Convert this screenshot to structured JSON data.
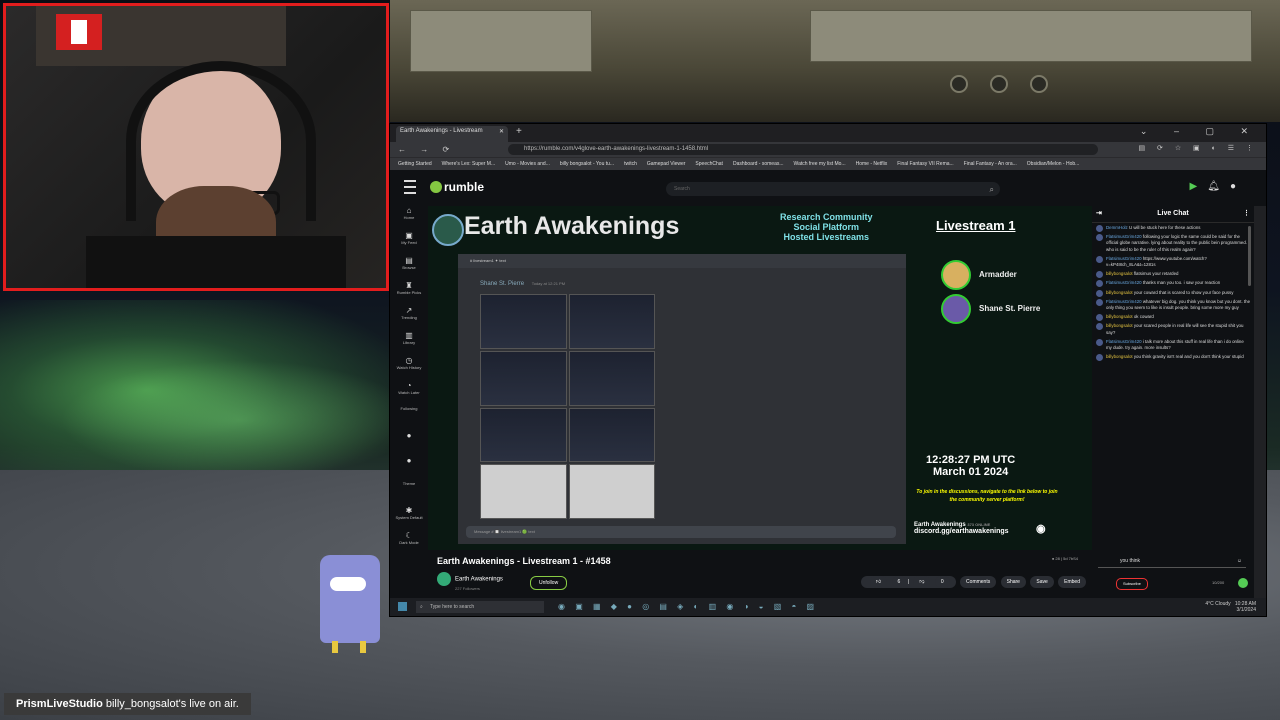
{
  "browser": {
    "tab_title": "Earth Awakenings - Livestream",
    "url": "https://rumble.com/v4glove-earth-awakenings-livestream-1-1458.html",
    "bookmarks": [
      "Getting Started",
      "Where's Lex: Super M...",
      "Umo - Movies and...",
      "billy bongsalot - You tu...",
      "twitch",
      "Gamepad Viewer",
      "SpeechChat",
      "Dashboard - someas...",
      "Watch free my list Mo...",
      "Home - Netflix",
      "Final Fantasy VII Rema...",
      "Final Fantasy - An ora...",
      "Obsidian/Melon - Hob..."
    ],
    "logo_text": "rumble",
    "search_placeholder": "Search"
  },
  "leftnav": [
    {
      "icon": "⌂",
      "label": "Home"
    },
    {
      "icon": "▣",
      "label": "My Feed"
    },
    {
      "icon": "▤",
      "label": "Browse"
    },
    {
      "icon": "♜",
      "label": "Rumble Picks"
    },
    {
      "icon": "↗",
      "label": "Trending"
    },
    {
      "icon": "▥",
      "label": "Library"
    },
    {
      "icon": "◷",
      "label": "Watch History"
    },
    {
      "icon": "◔",
      "label": "Watch Later"
    },
    {
      "icon": "",
      "label": "Following"
    },
    {
      "icon": "●",
      "label": ""
    },
    {
      "icon": "●",
      "label": ""
    },
    {
      "icon": "",
      "label": "Theme"
    },
    {
      "icon": "✱",
      "label": "System Default"
    },
    {
      "icon": "☾",
      "label": "Dark Mode"
    }
  ],
  "stream": {
    "title": "Earth Awakenings",
    "tagline": [
      "Research Community",
      "Social Platform",
      "Hosted Livestreams"
    ],
    "livestream_label": "Livestream 1",
    "hosts": [
      "Armadder",
      "Shane St. Pierre"
    ],
    "shared_channel": "# livestream1 ✦ text",
    "shared_user": "Shane St. Pierre",
    "shared_time": "Today at 12:21 PM",
    "message_placeholder": "Message # 🔲 livestream1 🟢 text",
    "time": "12:28:27 PM UTC",
    "date": "March 01 2024",
    "join_text": "To join in the discussions, navigate to the link below to join the community server platform!",
    "discord_name": "Earth Awakenings",
    "discord_online": "373 ONLINE",
    "discord_link": "discord.gg/earthawakenings"
  },
  "video": {
    "title": "Earth Awakenings - Livestream 1 - #1458",
    "channel": "Earth Awakenings",
    "followers": "227 Followers",
    "follow_label": "Unfollow",
    "likes": "6",
    "dislikes": "0",
    "buttons": [
      "Comments",
      "Share",
      "Save",
      "Embed"
    ],
    "stats": "● 28 | 5d 7bS4"
  },
  "chat": {
    "title": "Live Chat",
    "messages": [
      {
        "user": "DemmHolz",
        "text": "U will be stuck here for these actions",
        "blue": true
      },
      {
        "user": "FlatsimusGrim420",
        "text": "following your logic the same could be said for the official globe narrative. lying about reality to the public bein programmed. who is said to be the ruler of this realm again?",
        "blue": true
      },
      {
        "user": "FlatsimusGrim420",
        "text": "https://www.youtube.com/watch?v=kP4I8ch_8LA&t=1281s",
        "blue": true
      },
      {
        "user": "billybongsalot",
        "text": "flatsimus your retarded",
        "blue": false
      },
      {
        "user": "FlatsimusGrim420",
        "text": "thanks man you too. i saw your reaction",
        "blue": true
      },
      {
        "user": "billybongsalot",
        "text": "your coward that is scared to show your face pussy",
        "blue": false
      },
      {
        "user": "FlatsimusGrim420",
        "text": "whatever big dog. you think you know but you dont. the only thing you seem to like is insult people. bring some more my guy",
        "blue": true
      },
      {
        "user": "billybongsalot",
        "text": "ok coward",
        "blue": false
      },
      {
        "user": "billybongsalot",
        "text": "your scared people in real life will see the stupid shit you say?",
        "blue": false
      },
      {
        "user": "FlatsimusGrim420",
        "text": "i talk more about this stuff in real life than i do online my dude. try again. more insults?",
        "blue": true
      },
      {
        "user": "billybongsalot",
        "text": "you think gravity isn't real and you don't think your stupid",
        "blue": false
      }
    ],
    "input_value": "you think",
    "subscribe_label": "Subscribe",
    "char_count": "10/200"
  },
  "taskbar": {
    "search_placeholder": "Type here to search",
    "weather": "4°C Cloudy",
    "time": "10:28 AM",
    "date": "3/1/2024"
  },
  "overlay": {
    "app_name": "PrismLiveStudio",
    "status_text": "billy_bongsalot's live on air."
  }
}
